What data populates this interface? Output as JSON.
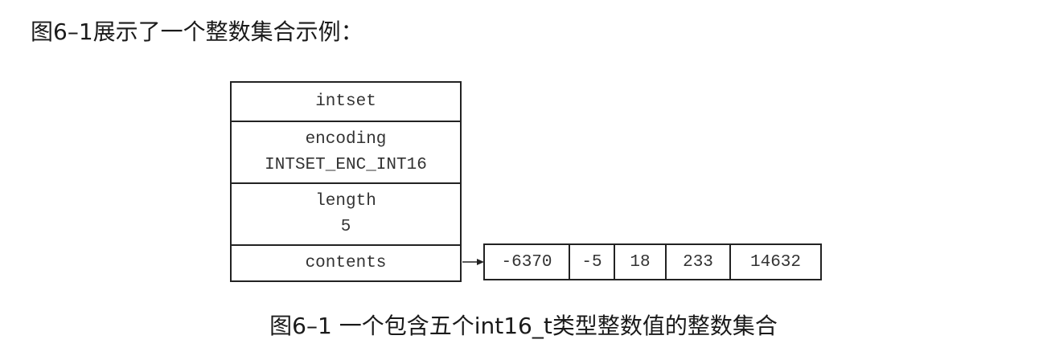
{
  "intro_text": "图6–1展示了一个整数集合示例：",
  "intset": {
    "title": "intset",
    "encoding_label": "encoding",
    "encoding_value": "INTSET_ENC_INT16",
    "length_label": "length",
    "length_value": "5",
    "contents_label": "contents"
  },
  "contents_array": [
    "-6370",
    "-5",
    "18",
    "233",
    "14632"
  ],
  "caption": "图6–1 一个包含五个int16_t类型整数值的整数集合"
}
